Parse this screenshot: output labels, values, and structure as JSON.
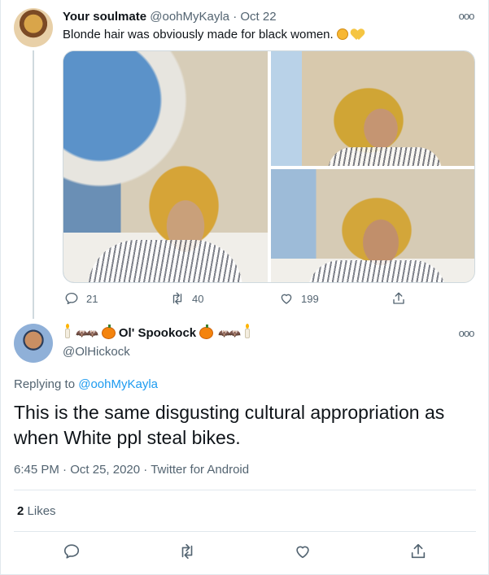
{
  "parent_tweet": {
    "display_name": "Your soulmate",
    "handle": "@oohMyKayla",
    "separator": "·",
    "date": "Oct 22",
    "text": "Blonde hair was obviously made for black women.",
    "emoji_icons": [
      "shrug-emoji-icon",
      "yellow-heart-emoji-icon"
    ],
    "images": [
      "photo-1",
      "photo-2",
      "photo-3"
    ],
    "replies": "21",
    "retweets": "40",
    "likes": "199"
  },
  "main_tweet": {
    "display_name": "Ol' Spookock",
    "name_decorations": [
      "candle-emoji-icon",
      "bats-emoji-icon",
      "pumpkin-emoji-icon"
    ],
    "handle": "@OlHickock",
    "replying_prefix": "Replying to",
    "replying_to": "@oohMyKayla",
    "text": "This is the same disgusting cultural appropriation as when White ppl steal bikes.",
    "time": "6:45 PM",
    "date": "Oct 25, 2020",
    "source": "Twitter for Android",
    "likes_count": "2",
    "likes_label": "Likes"
  },
  "colors": {
    "text": "#0f1419",
    "muted": "#536471",
    "link": "#1d9bf0",
    "divider": "#e1e8ed"
  }
}
